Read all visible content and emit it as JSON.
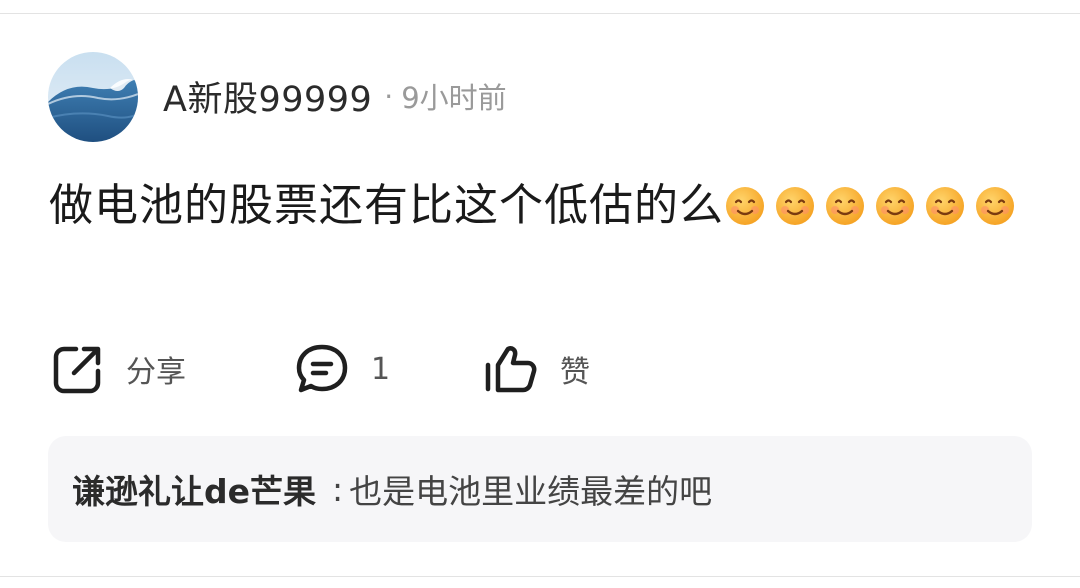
{
  "post": {
    "author": "A新股99999",
    "separator": "·",
    "time": "9小时前",
    "text": "做电池的股票还有比这个低估的么",
    "emoji_count": 6,
    "emoji_icon": "smiling-face-icon"
  },
  "actions": {
    "share_label": "分享",
    "comment_count": "1",
    "like_label": "赞"
  },
  "reply": {
    "user": "谦逊礼让de芒果",
    "colon": ":",
    "text": "也是电池里业绩最差的吧"
  },
  "colors": {
    "text_primary": "#1a1a1a",
    "text_secondary": "#9a9a9a",
    "reply_bg": "#f6f6f8"
  }
}
